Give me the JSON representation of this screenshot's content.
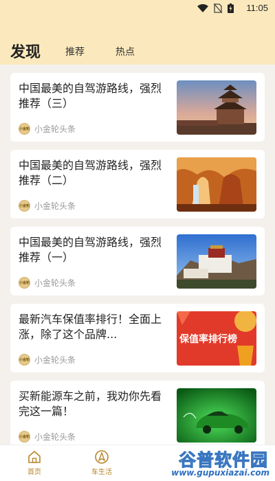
{
  "status_bar": {
    "time": "11:05",
    "icons": [
      "wifi-icon",
      "no-sim-icon",
      "battery-charging-icon"
    ]
  },
  "header": {
    "title": "发现",
    "tabs": [
      {
        "label": "推荐"
      },
      {
        "label": "热点"
      }
    ]
  },
  "feed": [
    {
      "title": "中国最美的自驾游路线，强烈推荐（三）",
      "source": "小金轮头条",
      "thumb": "pagoda-sunset"
    },
    {
      "title": "中国最美的自驾游路线，强烈推荐（二）",
      "source": "小金轮头条",
      "thumb": "canyon"
    },
    {
      "title": "中国最美的自驾游路线，强烈推荐（一）",
      "source": "小金轮头条",
      "thumb": "potala-palace"
    },
    {
      "title": "最新汽车保值率排行！全面上涨，除了这个品牌...",
      "source": "小金轮头条",
      "thumb": "value-ranking-banner",
      "thumb_text": "保值率排行榜"
    },
    {
      "title": "买新能源车之前，我劝你先看完这一篇！",
      "source": "小金轮头条",
      "thumb": "green-car"
    }
  ],
  "source_logo_text": "小金轮",
  "tabbar": {
    "items": [
      {
        "label": "首页",
        "icon": "home-icon"
      },
      {
        "label": "车生活",
        "icon": "navigation-icon"
      }
    ]
  },
  "watermark": {
    "title": "谷普软件园",
    "url": "www.gupuxiazai.com"
  },
  "colors": {
    "header_bg": "#fbe9bd",
    "accent": "#b8862a",
    "page_bg": "#f4f1ec"
  }
}
